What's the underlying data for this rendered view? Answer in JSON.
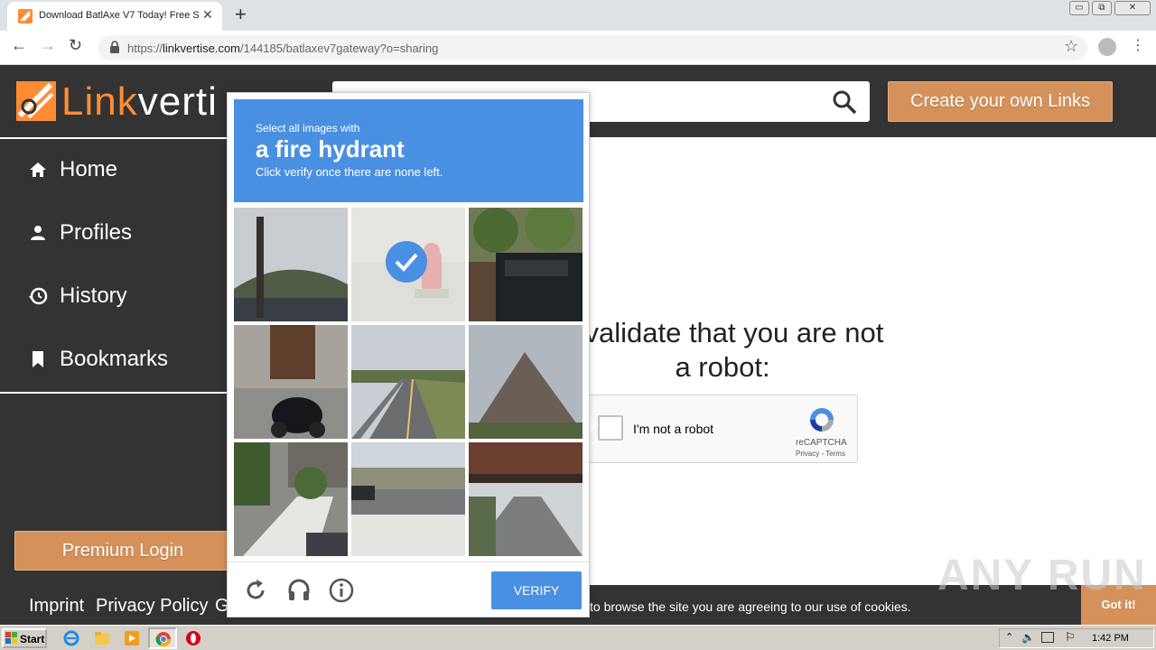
{
  "browser": {
    "tab_title": "Download BatlAxe V7 Today! Free S",
    "tab_close": "✕",
    "new_tab": "+",
    "url_prefix": "https://",
    "url_domain": "linkvertise.com",
    "url_path": "/144185/batlaxev7gateway?o=sharing",
    "window_buttons": [
      "▭",
      "⧉",
      "✕"
    ]
  },
  "header": {
    "logo_link": "Link",
    "logo_rest": "verti",
    "create_links_label": "Create your own Links"
  },
  "sidebar": {
    "items": [
      {
        "label": "Home",
        "icon": "home-icon"
      },
      {
        "label": "Profiles",
        "icon": "person-icon"
      },
      {
        "label": "History",
        "icon": "history-icon"
      },
      {
        "label": "Bookmarks",
        "icon": "bookmark-icon"
      }
    ],
    "premium_login_label": "Premium Login"
  },
  "main": {
    "title_line1": "e validate that you are not",
    "title_line2": "a robot:"
  },
  "recaptcha": {
    "label": "I'm not a robot",
    "brand": "reCAPTCHA",
    "terms": "Privacy - Terms"
  },
  "footer": {
    "links": [
      "Imprint",
      "Privacy Policy",
      "G"
    ],
    "cookie_text": "to browse the site you are agreeing to our use of cookies.",
    "got_it_label": "Got it!"
  },
  "challenge": {
    "select_text": "Select all images with",
    "object": "a fire hydrant",
    "hint": "Click verify once there are none left.",
    "verify_label": "VERIFY",
    "selected_tile": 1
  },
  "taskbar": {
    "start_label": "Start",
    "clock": "1:42 PM"
  },
  "watermark": "ANY RUN",
  "colors": {
    "accent_orange": "#d4915a",
    "logo_orange": "#ff8c33",
    "dark_bg": "#333333",
    "captcha_blue": "#4a90e2"
  }
}
